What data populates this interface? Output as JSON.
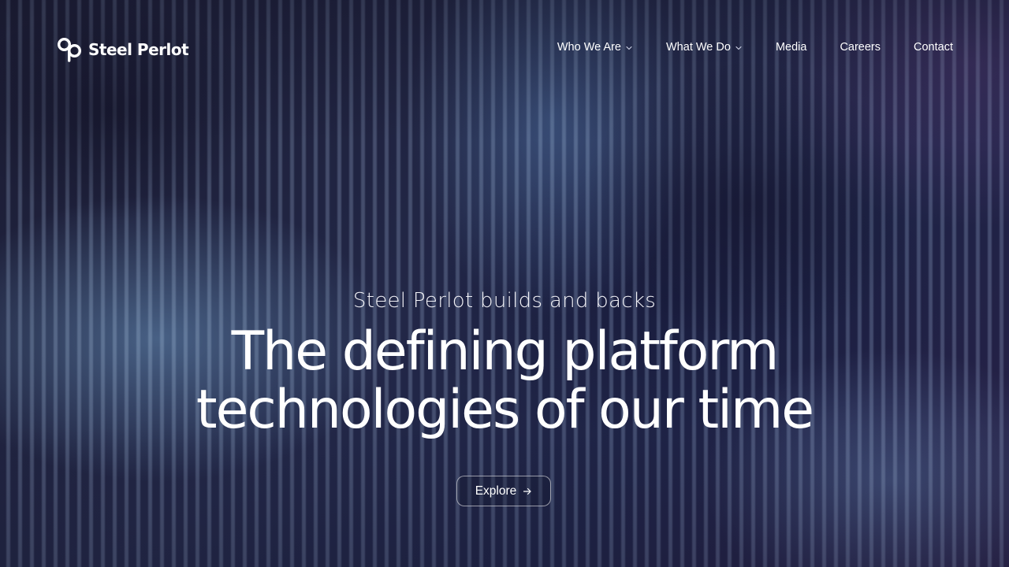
{
  "brand": {
    "name": "Steel Perlot",
    "logo_icon": "infinity-p-logo-icon"
  },
  "nav": {
    "items": [
      {
        "label": "Who We Are",
        "has_dropdown": true
      },
      {
        "label": "What We Do",
        "has_dropdown": true
      },
      {
        "label": "Media",
        "has_dropdown": false
      },
      {
        "label": "Careers",
        "has_dropdown": false
      },
      {
        "label": "Contact",
        "has_dropdown": false
      }
    ]
  },
  "hero": {
    "eyebrow": "Steel Perlot builds and backs",
    "headline_line1": "The defining platform",
    "headline_line2": "technologies of our time",
    "cta_label": "Explore",
    "cta_icon": "arrow-right-icon"
  },
  "colors": {
    "background": "#1b1d38",
    "text": "#ffffff",
    "stripe_highlight": "#b9d7ff"
  }
}
